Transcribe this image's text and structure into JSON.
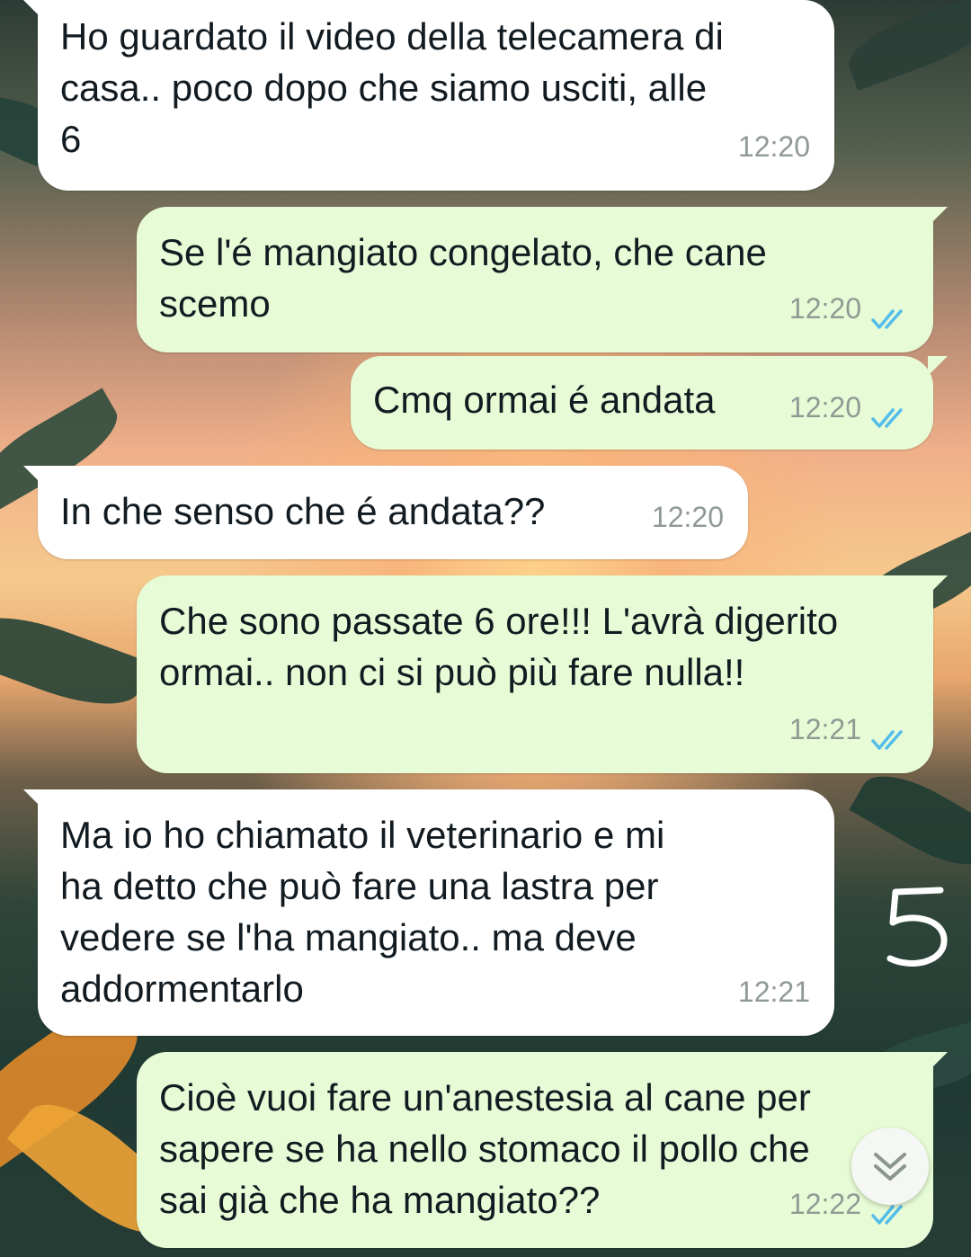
{
  "messages": [
    {
      "direction": "incoming",
      "text": "Ho guardato il video della telecamera di\ncasa.. poco dopo che siamo usciti, alle\n6",
      "time": "12:20"
    },
    {
      "direction": "outgoing",
      "text": "Se l'é mangiato congelato, che cane\nscemo",
      "time": "12:20",
      "status": "read"
    },
    {
      "direction": "outgoing",
      "text": "Cmq ormai é andata",
      "time": "12:20",
      "status": "read"
    },
    {
      "direction": "incoming",
      "text": "In che senso che é andata??",
      "time": "12:20"
    },
    {
      "direction": "outgoing",
      "text": "Che sono passate 6 ore!!! L'avrà digerito\normai.. non ci si può più fare nulla!!",
      "time": "12:21",
      "status": "read"
    },
    {
      "direction": "incoming",
      "text": "Ma io ho chiamato il veterinario e mi\nha detto che può fare una lastra per\nvedere se l'ha mangiato.. ma deve\naddormentarlo",
      "time": "12:21"
    },
    {
      "direction": "outgoing",
      "text": "Cioè vuoi fare un'anestesia al cane per\nsapere se ha nello stomaco il pollo che\nsai già che ha mangiato??",
      "time": "12:22",
      "status": "read"
    }
  ],
  "overlay": {
    "annotation": "5",
    "color": "#ffffff"
  },
  "colors": {
    "incoming_bubble": "#ffffff",
    "outgoing_bubble": "#e7fcd6",
    "timestamp": "#8f9a94",
    "read_ticks": "#53bdeb",
    "text": "#111b21"
  },
  "icons": {
    "read_receipt": "double-check-icon",
    "scroll_down": "double-chevron-down-icon"
  }
}
